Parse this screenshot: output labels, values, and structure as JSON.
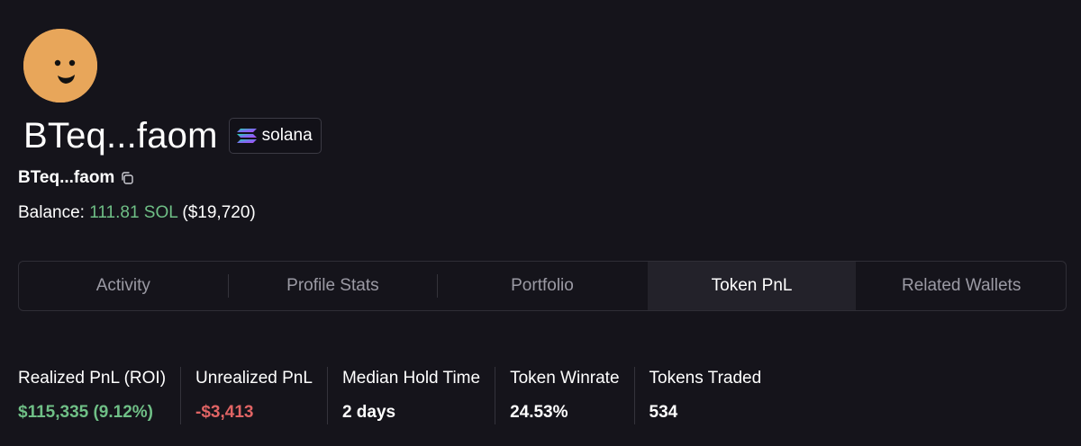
{
  "profile": {
    "title": "BTeq...faom",
    "chain_label": "solana",
    "address_short": "BTeq...faom",
    "balance_label": "Balance:",
    "balance_sol": "111.81 SOL",
    "balance_usd": "($19,720)"
  },
  "tabs": [
    {
      "label": "Activity",
      "active": false
    },
    {
      "label": "Profile Stats",
      "active": false
    },
    {
      "label": "Portfolio",
      "active": false
    },
    {
      "label": "Token PnL",
      "active": true
    },
    {
      "label": "Related Wallets",
      "active": false
    }
  ],
  "stats": [
    {
      "label": "Realized PnL (ROI)",
      "value": "$115,335 (9.12%)",
      "tone": "green"
    },
    {
      "label": "Unrealized PnL",
      "value": "-$3,413",
      "tone": "red"
    },
    {
      "label": "Median Hold Time",
      "value": "2 days",
      "tone": "white"
    },
    {
      "label": "Token Winrate",
      "value": "24.53%",
      "tone": "white"
    },
    {
      "label": "Tokens Traded",
      "value": "534",
      "tone": "white"
    }
  ],
  "colors": {
    "background": "#15141b",
    "positive": "#6fbf86",
    "negative": "#e06464",
    "avatar": "#e8a65a"
  },
  "icons": {
    "avatar": "smiley-face-icon",
    "chain": "solana-logo-icon",
    "copy": "copy-icon"
  }
}
